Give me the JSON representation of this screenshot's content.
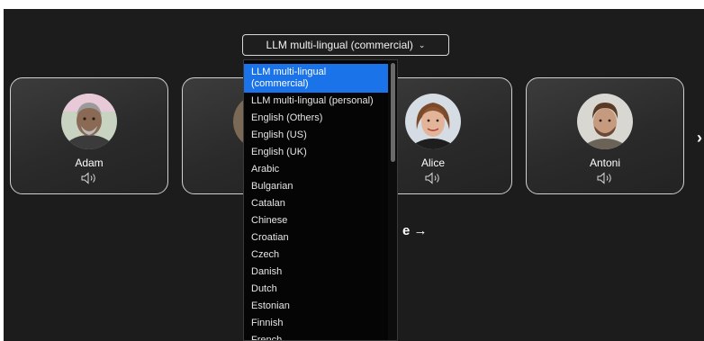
{
  "language_select": {
    "selected": "LLM multi-lingual (commercial)",
    "options": [
      "LLM multi-lingual (commercial)",
      "LLM multi-lingual (personal)",
      "English (Others)",
      "English (US)",
      "English (UK)",
      "Arabic",
      "Bulgarian",
      "Catalan",
      "Chinese",
      "Croatian",
      "Czech",
      "Danish",
      "Dutch",
      "Estonian",
      "Finnish",
      "French"
    ]
  },
  "voices": [
    {
      "name": "Adam"
    },
    {
      "name": ""
    },
    {
      "name": "Alice"
    },
    {
      "name": "Antoni"
    }
  ],
  "bottom_link": "e →",
  "next_arrow": "›",
  "colors": {
    "background": "#1c1c1c",
    "card_border": "#d0d0d0",
    "selected_option": "#1a73e8"
  },
  "icons": {
    "speaker": "speaker-icon",
    "chevron": "chevron-down-icon"
  }
}
